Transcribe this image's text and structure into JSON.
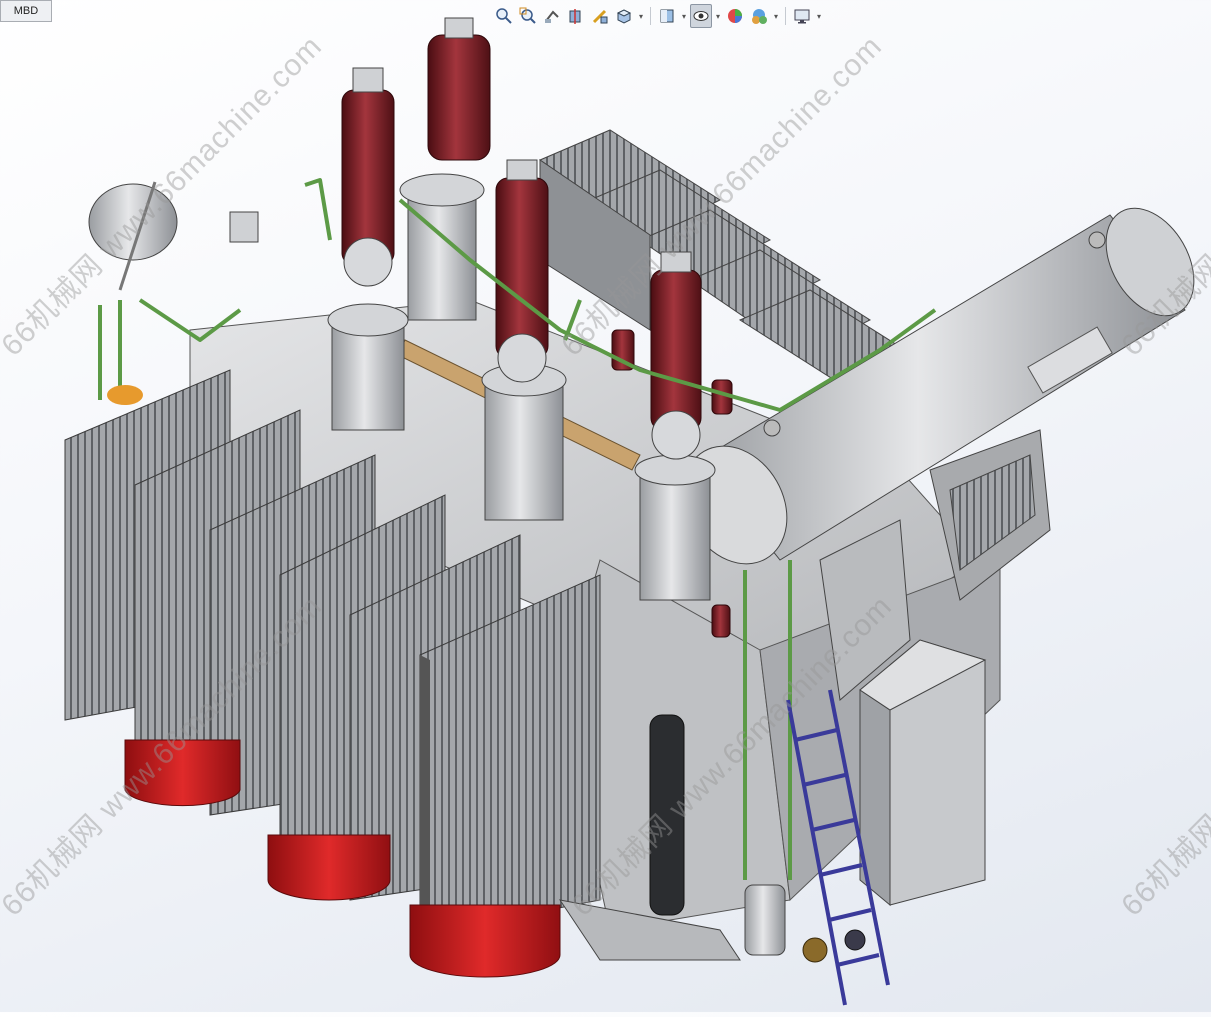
{
  "tab": {
    "label": "MBD"
  },
  "toolbar": {
    "buttons": [
      {
        "name": "zoom-to-fit-icon"
      },
      {
        "name": "zoom-to-area-icon"
      },
      {
        "name": "previous-view-icon"
      },
      {
        "name": "section-view-icon"
      },
      {
        "name": "dynamic-annotation-icon"
      },
      {
        "name": "view-orientation-icon"
      },
      {
        "name": "display-style-icon"
      },
      {
        "name": "hide-show-items-icon"
      },
      {
        "name": "edit-appearance-icon"
      },
      {
        "name": "apply-scene-icon"
      },
      {
        "name": "view-settings-icon"
      }
    ]
  },
  "watermark": {
    "texts": [
      "66机械网 www.66machine.com",
      "66机械网 www.66machine.com",
      "66机械网 www.66machine.com",
      "66机械网 www.66machine.com",
      "66机械网 www.66machine.com",
      "66机械网 www.66machine.com",
      "66机械网 www.66machine.com"
    ]
  },
  "colors": {
    "steel": "#c8cacd",
    "steel_dark": "#8f9297",
    "insulator": "#7a1c24",
    "base_red": "#c8171b",
    "pipe_green": "#5c9a46",
    "ladder_blue": "#3a3a9a",
    "wood": "#c9a36e"
  }
}
